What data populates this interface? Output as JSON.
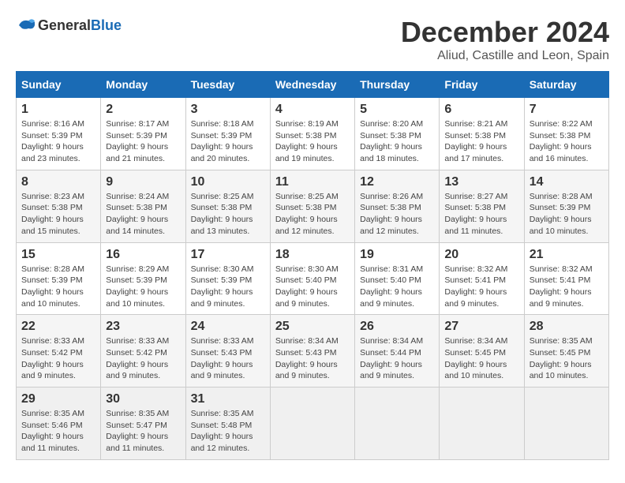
{
  "logo": {
    "general": "General",
    "blue": "Blue"
  },
  "title": "December 2024",
  "subtitle": "Aliud, Castille and Leon, Spain",
  "headers": [
    "Sunday",
    "Monday",
    "Tuesday",
    "Wednesday",
    "Thursday",
    "Friday",
    "Saturday"
  ],
  "weeks": [
    [
      {
        "day": "1",
        "sunrise": "Sunrise: 8:16 AM",
        "sunset": "Sunset: 5:39 PM",
        "daylight": "Daylight: 9 hours and 23 minutes."
      },
      {
        "day": "2",
        "sunrise": "Sunrise: 8:17 AM",
        "sunset": "Sunset: 5:39 PM",
        "daylight": "Daylight: 9 hours and 21 minutes."
      },
      {
        "day": "3",
        "sunrise": "Sunrise: 8:18 AM",
        "sunset": "Sunset: 5:39 PM",
        "daylight": "Daylight: 9 hours and 20 minutes."
      },
      {
        "day": "4",
        "sunrise": "Sunrise: 8:19 AM",
        "sunset": "Sunset: 5:38 PM",
        "daylight": "Daylight: 9 hours and 19 minutes."
      },
      {
        "day": "5",
        "sunrise": "Sunrise: 8:20 AM",
        "sunset": "Sunset: 5:38 PM",
        "daylight": "Daylight: 9 hours and 18 minutes."
      },
      {
        "day": "6",
        "sunrise": "Sunrise: 8:21 AM",
        "sunset": "Sunset: 5:38 PM",
        "daylight": "Daylight: 9 hours and 17 minutes."
      },
      {
        "day": "7",
        "sunrise": "Sunrise: 8:22 AM",
        "sunset": "Sunset: 5:38 PM",
        "daylight": "Daylight: 9 hours and 16 minutes."
      }
    ],
    [
      {
        "day": "8",
        "sunrise": "Sunrise: 8:23 AM",
        "sunset": "Sunset: 5:38 PM",
        "daylight": "Daylight: 9 hours and 15 minutes."
      },
      {
        "day": "9",
        "sunrise": "Sunrise: 8:24 AM",
        "sunset": "Sunset: 5:38 PM",
        "daylight": "Daylight: 9 hours and 14 minutes."
      },
      {
        "day": "10",
        "sunrise": "Sunrise: 8:25 AM",
        "sunset": "Sunset: 5:38 PM",
        "daylight": "Daylight: 9 hours and 13 minutes."
      },
      {
        "day": "11",
        "sunrise": "Sunrise: 8:25 AM",
        "sunset": "Sunset: 5:38 PM",
        "daylight": "Daylight: 9 hours and 12 minutes."
      },
      {
        "day": "12",
        "sunrise": "Sunrise: 8:26 AM",
        "sunset": "Sunset: 5:38 PM",
        "daylight": "Daylight: 9 hours and 12 minutes."
      },
      {
        "day": "13",
        "sunrise": "Sunrise: 8:27 AM",
        "sunset": "Sunset: 5:38 PM",
        "daylight": "Daylight: 9 hours and 11 minutes."
      },
      {
        "day": "14",
        "sunrise": "Sunrise: 8:28 AM",
        "sunset": "Sunset: 5:39 PM",
        "daylight": "Daylight: 9 hours and 10 minutes."
      }
    ],
    [
      {
        "day": "15",
        "sunrise": "Sunrise: 8:28 AM",
        "sunset": "Sunset: 5:39 PM",
        "daylight": "Daylight: 9 hours and 10 minutes."
      },
      {
        "day": "16",
        "sunrise": "Sunrise: 8:29 AM",
        "sunset": "Sunset: 5:39 PM",
        "daylight": "Daylight: 9 hours and 10 minutes."
      },
      {
        "day": "17",
        "sunrise": "Sunrise: 8:30 AM",
        "sunset": "Sunset: 5:39 PM",
        "daylight": "Daylight: 9 hours and 9 minutes."
      },
      {
        "day": "18",
        "sunrise": "Sunrise: 8:30 AM",
        "sunset": "Sunset: 5:40 PM",
        "daylight": "Daylight: 9 hours and 9 minutes."
      },
      {
        "day": "19",
        "sunrise": "Sunrise: 8:31 AM",
        "sunset": "Sunset: 5:40 PM",
        "daylight": "Daylight: 9 hours and 9 minutes."
      },
      {
        "day": "20",
        "sunrise": "Sunrise: 8:32 AM",
        "sunset": "Sunset: 5:41 PM",
        "daylight": "Daylight: 9 hours and 9 minutes."
      },
      {
        "day": "21",
        "sunrise": "Sunrise: 8:32 AM",
        "sunset": "Sunset: 5:41 PM",
        "daylight": "Daylight: 9 hours and 9 minutes."
      }
    ],
    [
      {
        "day": "22",
        "sunrise": "Sunrise: 8:33 AM",
        "sunset": "Sunset: 5:42 PM",
        "daylight": "Daylight: 9 hours and 9 minutes."
      },
      {
        "day": "23",
        "sunrise": "Sunrise: 8:33 AM",
        "sunset": "Sunset: 5:42 PM",
        "daylight": "Daylight: 9 hours and 9 minutes."
      },
      {
        "day": "24",
        "sunrise": "Sunrise: 8:33 AM",
        "sunset": "Sunset: 5:43 PM",
        "daylight": "Daylight: 9 hours and 9 minutes."
      },
      {
        "day": "25",
        "sunrise": "Sunrise: 8:34 AM",
        "sunset": "Sunset: 5:43 PM",
        "daylight": "Daylight: 9 hours and 9 minutes."
      },
      {
        "day": "26",
        "sunrise": "Sunrise: 8:34 AM",
        "sunset": "Sunset: 5:44 PM",
        "daylight": "Daylight: 9 hours and 9 minutes."
      },
      {
        "day": "27",
        "sunrise": "Sunrise: 8:34 AM",
        "sunset": "Sunset: 5:45 PM",
        "daylight": "Daylight: 9 hours and 10 minutes."
      },
      {
        "day": "28",
        "sunrise": "Sunrise: 8:35 AM",
        "sunset": "Sunset: 5:45 PM",
        "daylight": "Daylight: 9 hours and 10 minutes."
      }
    ],
    [
      {
        "day": "29",
        "sunrise": "Sunrise: 8:35 AM",
        "sunset": "Sunset: 5:46 PM",
        "daylight": "Daylight: 9 hours and 11 minutes."
      },
      {
        "day": "30",
        "sunrise": "Sunrise: 8:35 AM",
        "sunset": "Sunset: 5:47 PM",
        "daylight": "Daylight: 9 hours and 11 minutes."
      },
      {
        "day": "31",
        "sunrise": "Sunrise: 8:35 AM",
        "sunset": "Sunset: 5:48 PM",
        "daylight": "Daylight: 9 hours and 12 minutes."
      },
      null,
      null,
      null,
      null
    ]
  ]
}
